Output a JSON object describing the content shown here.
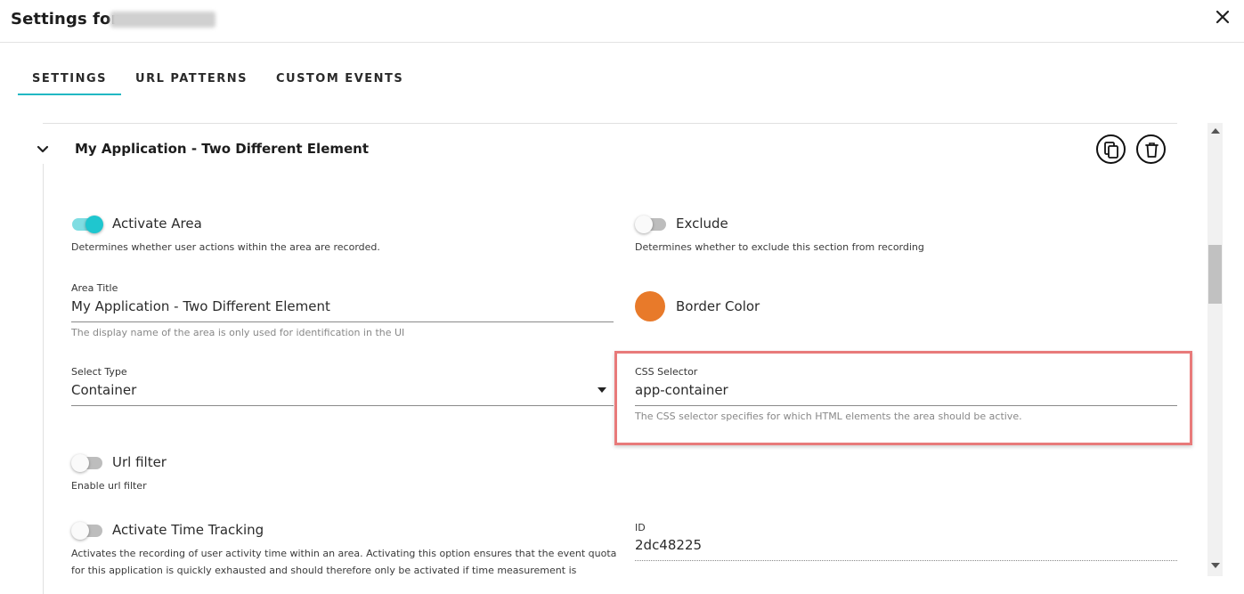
{
  "header": {
    "title": "Settings for",
    "close_icon": "close-icon"
  },
  "tabs": [
    {
      "label": "SETTINGS",
      "active": true
    },
    {
      "label": "URL PATTERNS",
      "active": false
    },
    {
      "label": "CUSTOM EVENTS",
      "active": false
    }
  ],
  "panel": {
    "title": "My Application - Two Different Element",
    "actions": [
      "copy-icon",
      "trash-icon"
    ]
  },
  "activate_area": {
    "label": "Activate Area",
    "enabled": true,
    "hint": "Determines whether user actions within the area are recorded."
  },
  "exclude": {
    "label": "Exclude",
    "enabled": false,
    "hint": "Determines whether to exclude this section from recording"
  },
  "area_title": {
    "label": "Area Title",
    "value": "My Application - Two Different Element",
    "hint": "The display name of the area is only used for identification in the UI"
  },
  "border_color": {
    "label": "Border Color",
    "color": "#e87a2a"
  },
  "select_type": {
    "label": "Select Type",
    "value": "Container"
  },
  "css_selector": {
    "label": "CSS Selector",
    "value": "app-container",
    "hint": "The CSS selector specifies for which HTML elements the area should be active."
  },
  "url_filter": {
    "label": "Url filter",
    "enabled": false,
    "hint": "Enable url filter"
  },
  "time_tracking": {
    "label": "Activate Time Tracking",
    "enabled": false,
    "hint_line1": "Activates the recording of user activity time within an area. Activating this option ensures that the event quota",
    "hint_line2": "for this application is quickly exhausted and should therefore only be activated if time measurement is"
  },
  "id_field": {
    "label": "ID",
    "value": "2dc48225"
  },
  "colors": {
    "accent": "#21b8c3",
    "toggle_on": "#1fc6cf",
    "highlight": "#e87a7a"
  }
}
